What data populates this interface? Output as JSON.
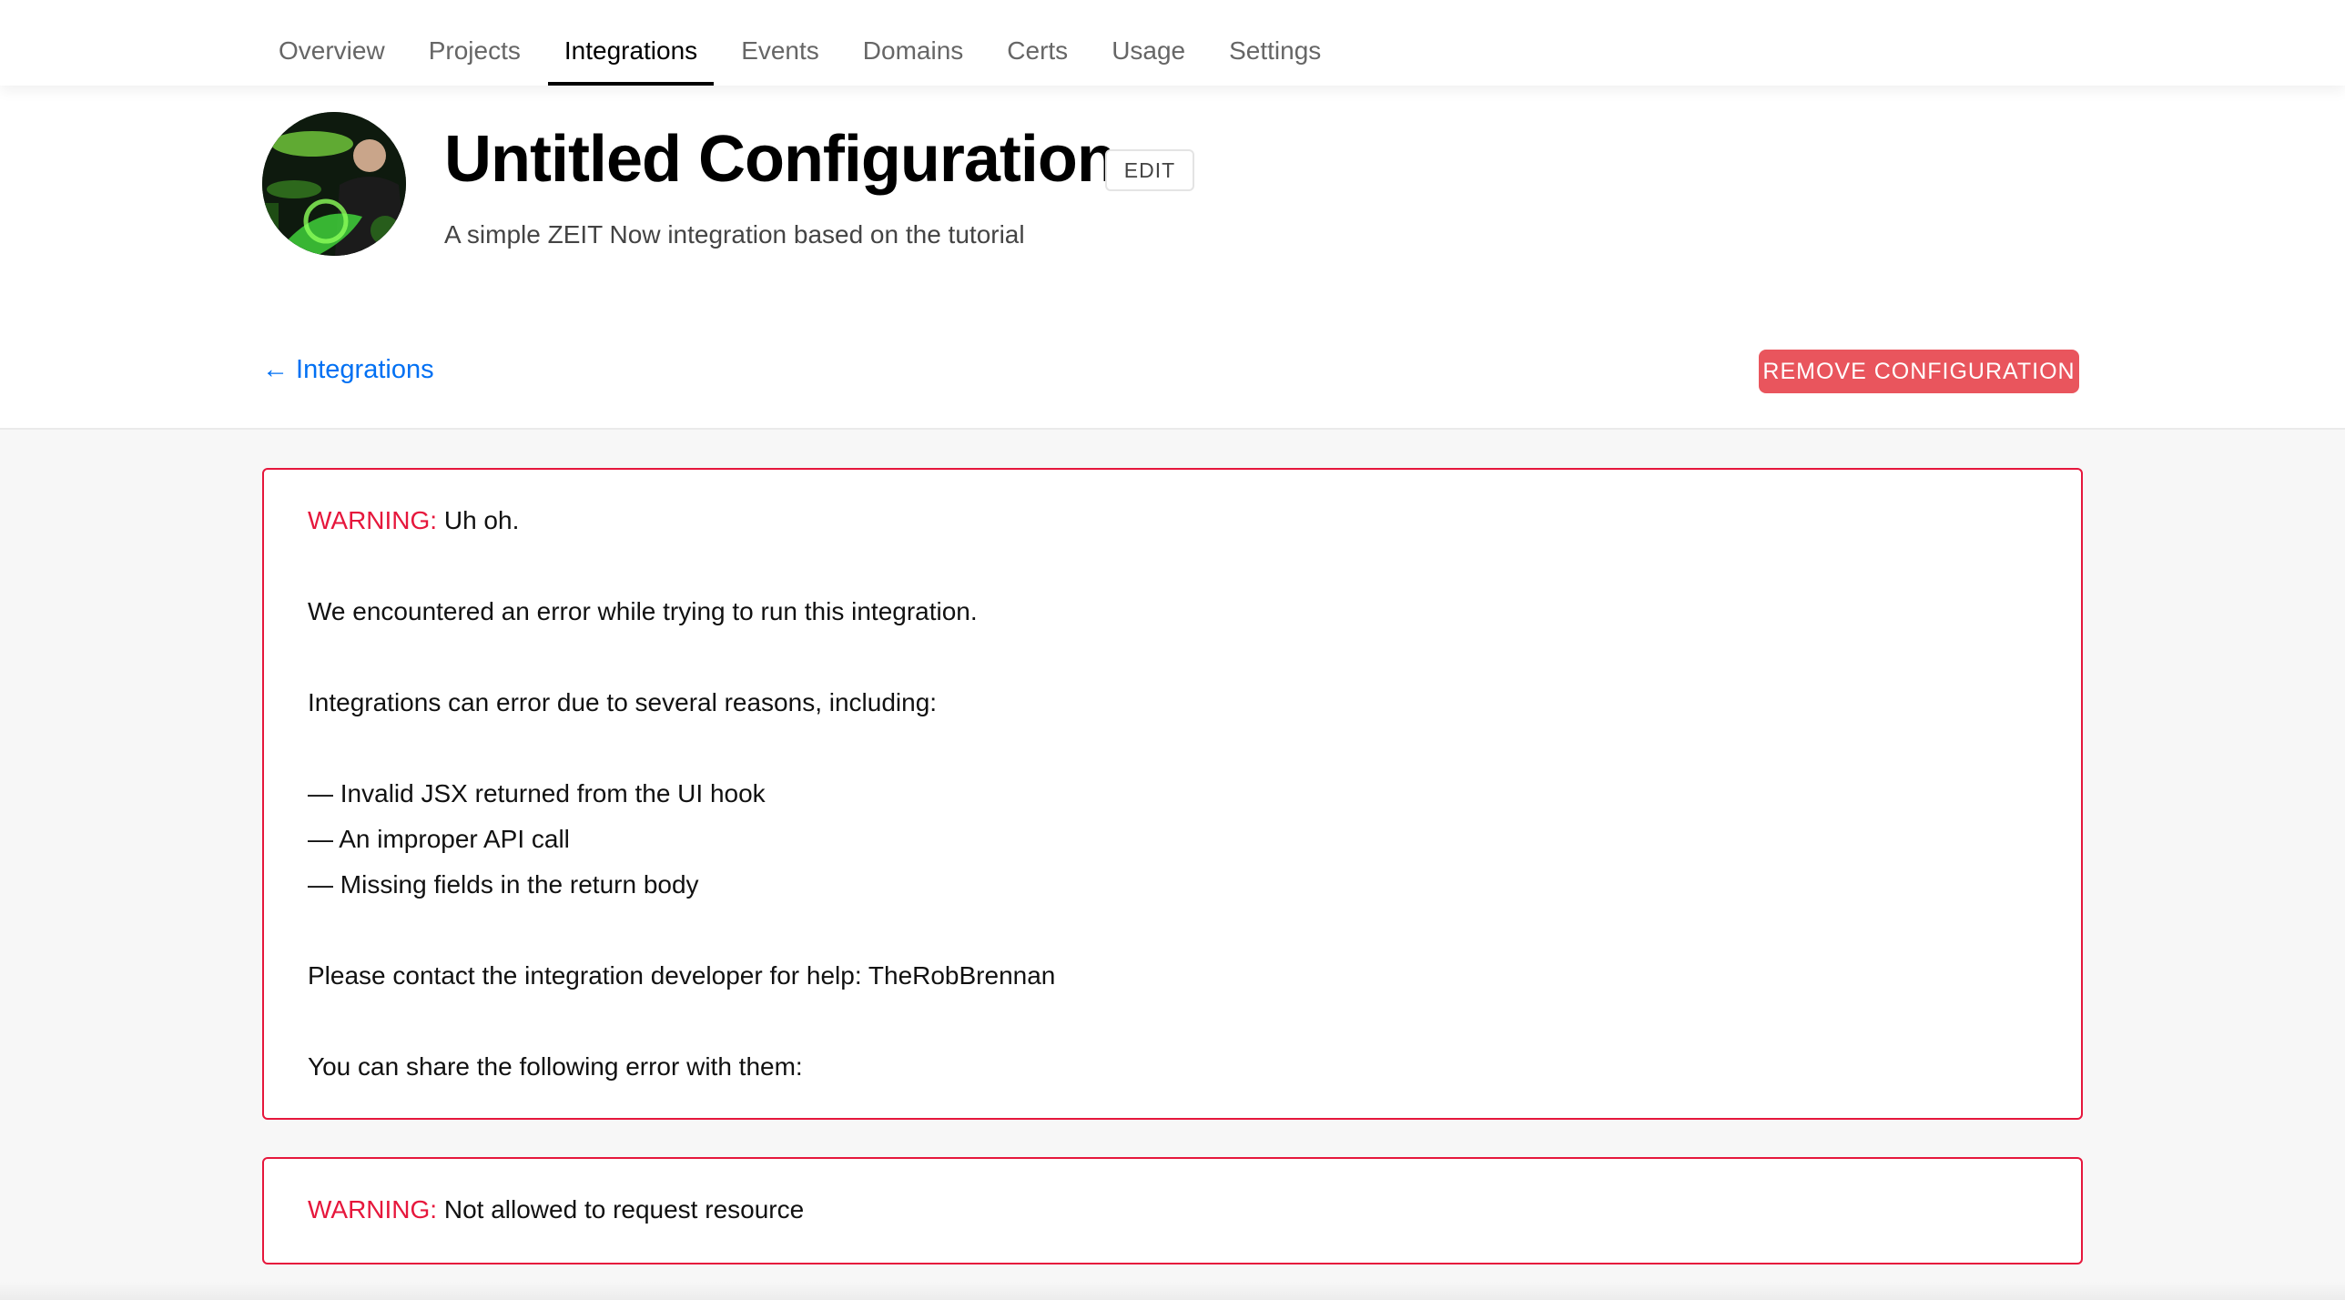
{
  "nav": {
    "items": [
      {
        "label": "Overview"
      },
      {
        "label": "Projects"
      },
      {
        "label": "Integrations",
        "active": true
      },
      {
        "label": "Events"
      },
      {
        "label": "Domains"
      },
      {
        "label": "Certs"
      },
      {
        "label": "Usage"
      },
      {
        "label": "Settings"
      }
    ]
  },
  "header": {
    "title": "Untitled Configuration",
    "edit_label": "EDIT",
    "subtitle": "A simple ZEIT Now integration based on the tutorial",
    "back_link": "← Integrations",
    "remove_label": "REMOVE CONFIGURATION"
  },
  "warning_main": {
    "label": "WARNING:",
    "heading": " Uh oh.",
    "error_text": "We encountered an error while trying to run this integration.",
    "reasons_intro": "Integrations can error due to several reasons, including:",
    "reasons": [
      "— Invalid JSX returned from the UI hook",
      "— An improper API call",
      "— Missing fields in the return body"
    ],
    "contact": "Please contact the integration developer for help: TheRobBrennan",
    "share": "You can share the following error with them:"
  },
  "warning_secondary": {
    "label": "WARNING:",
    "message": " Not allowed to request resource"
  },
  "colors": {
    "accent_link": "#0070f3",
    "danger": "#e6173c",
    "remove_button": "#e9555d"
  }
}
